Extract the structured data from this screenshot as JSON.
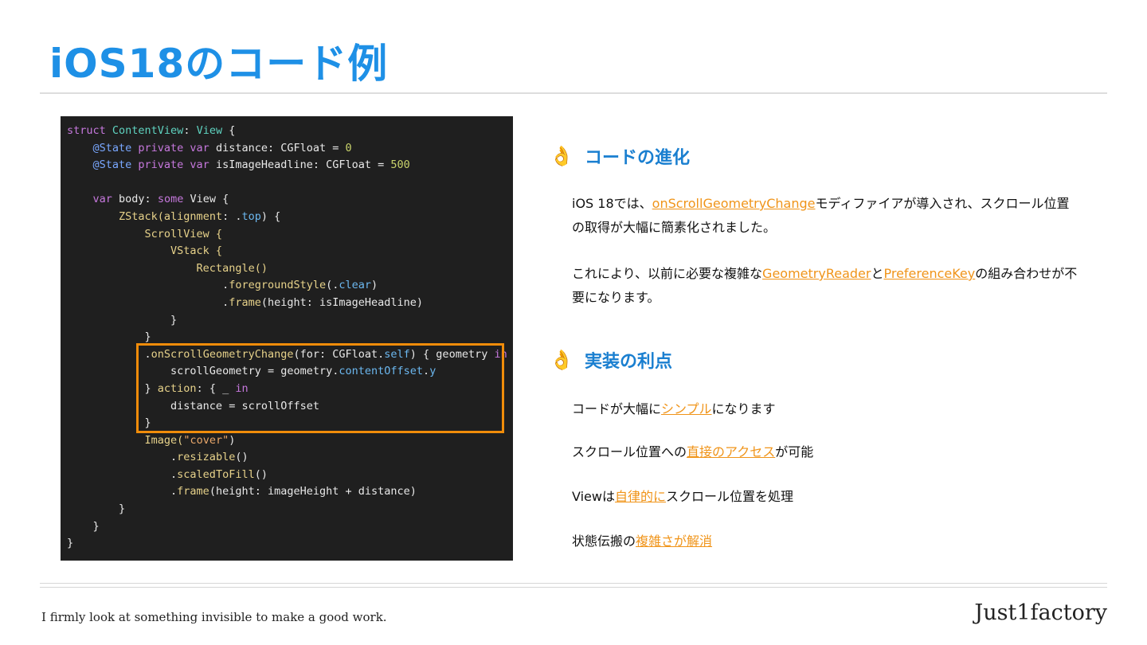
{
  "slide": {
    "title": "iOS18のコード例"
  },
  "code": {
    "l1a": "struct ",
    "l1b": "ContentView",
    "l1c": ": ",
    "l1d": "View",
    "l1e": " {",
    "l2a": "    @State ",
    "l2b": "private var",
    "l2c": " distance: CGFloat = ",
    "l2d": "0",
    "l3a": "    @State ",
    "l3b": "private var",
    "l3c": " isImageHeadline: CGFloat = ",
    "l3d": "500",
    "l5a": "    var",
    "l5b": " body: ",
    "l5c": "some",
    "l5d": " View {",
    "l6a": "        ZStack(",
    "l6b": "alignment",
    "l6c": ": .",
    "l6d": "top",
    "l6e": ") {",
    "l7": "            ScrollView {",
    "l8": "                VStack {",
    "l9": "                    Rectangle()",
    "l10a": "                        .",
    "l10b": "foregroundStyle",
    "l10c": "(.",
    "l10d": "clear",
    "l10e": ")",
    "l11a": "                        .",
    "l11b": "frame",
    "l11c": "(height: isImageHeadline)",
    "l12": "                }",
    "l13": "            }",
    "l14a": "            .",
    "l14b": "onScrollGeometryChange",
    "l14c": "(for: CGFloat.",
    "l14d": "self",
    "l14e": ") { geometry ",
    "l14f": "in",
    "l15a": "                scrollGeometry = geometry.",
    "l15b": "contentOffset",
    "l15c": ".",
    "l15d": "y",
    "l16a": "            } ",
    "l16b": "action",
    "l16c": ": { _ ",
    "l16d": "in",
    "l17": "                distance = scrollOffset",
    "l18": "            }",
    "l19a": "            Image(",
    "l19b": "\"cover\"",
    "l19c": ")",
    "l20a": "                .",
    "l20b": "resizable",
    "l20c": "()",
    "l21a": "                .",
    "l21b": "scaledToFill",
    "l21c": "()",
    "l22a": "                .",
    "l22b": "frame",
    "l22c": "(height: imageHeight + distance)",
    "l23": "        }",
    "l24": "    }",
    "l25": "}"
  },
  "sections": {
    "evolution": {
      "icon": "👌",
      "title": "コードの進化",
      "p1a": "iOS 18では、",
      "p1link": "onScrollGeometryChange",
      "p1b": "モディファイアが導入され、スクロール位置の取得が大幅に簡素化されました。",
      "p2a": "これにより、以前に必要な複雑な",
      "p2link1": "GeometryReader",
      "p2b": "と",
      "p2link2": "PreferenceKey",
      "p2c": "の組み合わせが不要になります。"
    },
    "benefits": {
      "icon": "👌",
      "title": "実装の利点",
      "i1a": "コードが大幅に",
      "i1link": "シンプル",
      "i1b": "になります",
      "i2a": "スクロール位置への",
      "i2link": "直接のアクセス",
      "i2b": "が可能",
      "i3a": "Viewは",
      "i3link": "自律的に",
      "i3b": "スクロール位置を処理",
      "i4a": "状態伝搬の",
      "i4link": "複雑さが解消"
    }
  },
  "footer": {
    "tagline": "I firmly look at something invisible to make a good work.",
    "brand": "Just1factory"
  },
  "colors": {
    "title": "#1e90e6",
    "link": "#f09419",
    "highlight_border": "#f08c0a",
    "code_bg": "#1f1f1f"
  }
}
